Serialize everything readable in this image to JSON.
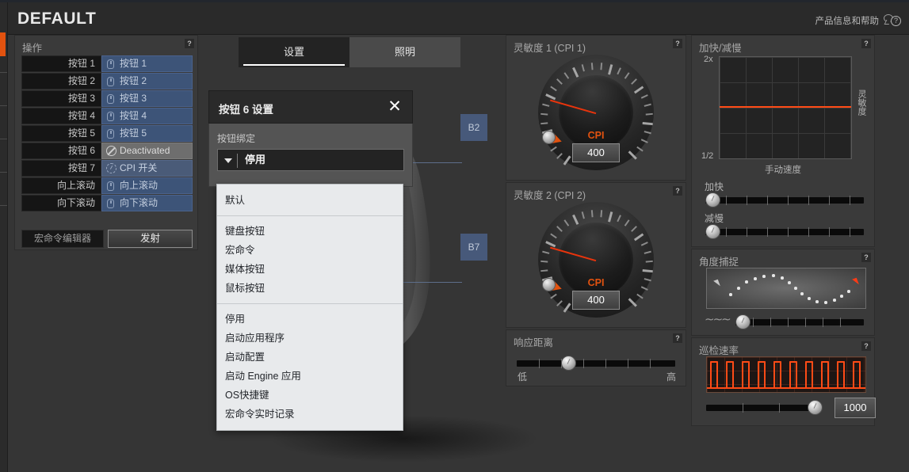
{
  "header": {
    "title": "DEFAULT",
    "help_text": "产品信息和帮助",
    "help_icon": "help-bubble-icon"
  },
  "tabs": [
    {
      "label": "设置",
      "active": true
    },
    {
      "label": "照明",
      "active": false
    }
  ],
  "actions_panel": {
    "title": "操作",
    "help": "?",
    "rows": [
      {
        "label": "按钮 1",
        "value": "按钮 1",
        "icon": "mouse-icon",
        "state": "normal"
      },
      {
        "label": "按钮 2",
        "value": "按钮 2",
        "icon": "mouse-icon",
        "state": "normal"
      },
      {
        "label": "按钮 3",
        "value": "按钮 3",
        "icon": "mouse-icon",
        "state": "normal"
      },
      {
        "label": "按钮 4",
        "value": "按钮 4",
        "icon": "mouse-icon",
        "state": "normal"
      },
      {
        "label": "按钮 5",
        "value": "按钮 5",
        "icon": "mouse-icon",
        "state": "normal"
      },
      {
        "label": "按钮 6",
        "value": "Deactivated",
        "icon": "prohibited-icon",
        "state": "deactivated"
      },
      {
        "label": "按钮 7",
        "value": "CPI 开关",
        "icon": "cpi-gauge-icon",
        "state": "cpi-switch"
      },
      {
        "label": "向上滚动",
        "value": "向上滚动",
        "icon": "mouse-icon",
        "state": "normal"
      },
      {
        "label": "向下滚动",
        "value": "向下滚动",
        "icon": "mouse-icon",
        "state": "normal"
      }
    ],
    "macro_editor_label": "宏命令编辑器",
    "fire_label": "发射"
  },
  "callouts": [
    {
      "label": "B2"
    },
    {
      "label": "B7"
    }
  ],
  "modal": {
    "title": "按钮 6 设置",
    "close_icon": "close-icon",
    "binding_label": "按钮绑定",
    "selected_value": "停用",
    "dropdown_groups": [
      {
        "items": [
          "默认"
        ]
      },
      {
        "items": [
          "键盘按钮",
          "宏命令",
          "媒体按钮",
          "鼠标按钮"
        ]
      },
      {
        "items": [
          "停用",
          "启动应用程序",
          "启动配置",
          "启动 Engine 应用",
          "OS快捷键",
          "宏命令实时记录"
        ]
      }
    ]
  },
  "sensitivity1": {
    "title": "灵敏度 1 (CPI 1)",
    "help": "?",
    "cpi_label": "CPI",
    "value": "400"
  },
  "sensitivity2": {
    "title": "灵敏度 2 (CPI 2)",
    "help": "?",
    "cpi_label": "CPI",
    "value": "400"
  },
  "response_distance": {
    "title": "响应距离",
    "help": "?",
    "min_label": "低",
    "max_label": "高"
  },
  "acceleration": {
    "title": "加快/减慢",
    "help": "?",
    "y_max_label": "2x",
    "y_min_label": "1/2",
    "y_axis_label": "灵敏度",
    "x_axis_label": "手动速度",
    "accelerate_label": "加快",
    "decelerate_label": "减慢"
  },
  "angle_snapping": {
    "title": "角度捕捉",
    "help": "?",
    "wave_icon": "wave-icon"
  },
  "polling_rate": {
    "title": "巡检速率",
    "help": "?",
    "value": "1000"
  },
  "colors": {
    "accent_orange": "#e2520f",
    "graph_orange": "#ff4b16",
    "row_blue": "#3d5478",
    "callout_blue": "#47597a",
    "panel_bg": "#3a3a3a"
  }
}
